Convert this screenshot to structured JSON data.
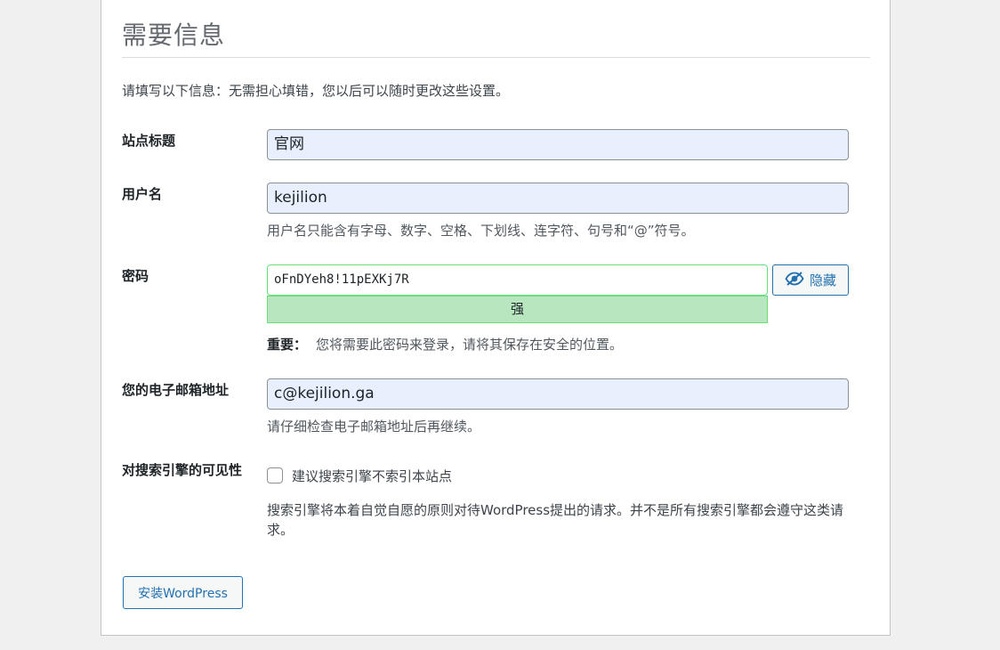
{
  "page": {
    "title": "需要信息",
    "intro": "请填写以下信息：无需担心填错，您以后可以随时更改这些设置。"
  },
  "form": {
    "site_title": {
      "label": "站点标题",
      "value": "官网"
    },
    "username": {
      "label": "用户名",
      "value": "kejilion",
      "help": "用户名只能含有字母、数字、空格、下划线、连字符、句号和“@”符号。"
    },
    "password": {
      "label": "密码",
      "value": "oFnDYeh8!11pEXKj7R",
      "toggle_label": "隐藏",
      "toggle_icon": "eye-slash-icon",
      "strength": "强",
      "important_label": "重要：",
      "important_text": "您将需要此密码来登录，请将其保存在安全的位置。"
    },
    "email": {
      "label": "您的电子邮箱地址",
      "value": "c@kejilion.ga",
      "help": "请仔细检查电子邮箱地址后再继续。"
    },
    "visibility": {
      "label": "对搜索引擎的可见性",
      "checkbox_label": "建议搜索引擎不索引本站点",
      "checked": false,
      "help": "搜索引擎将本着自觉自愿的原则对待WordPress提出的请求。并不是所有搜索引擎都会遵守这类请求。"
    }
  },
  "submit_label": "安装WordPress",
  "colors": {
    "accent": "#2271b1",
    "strong_bg": "#b8e6bf",
    "strong_border": "#68de7c",
    "autofill_bg": "#e8f0fe"
  }
}
